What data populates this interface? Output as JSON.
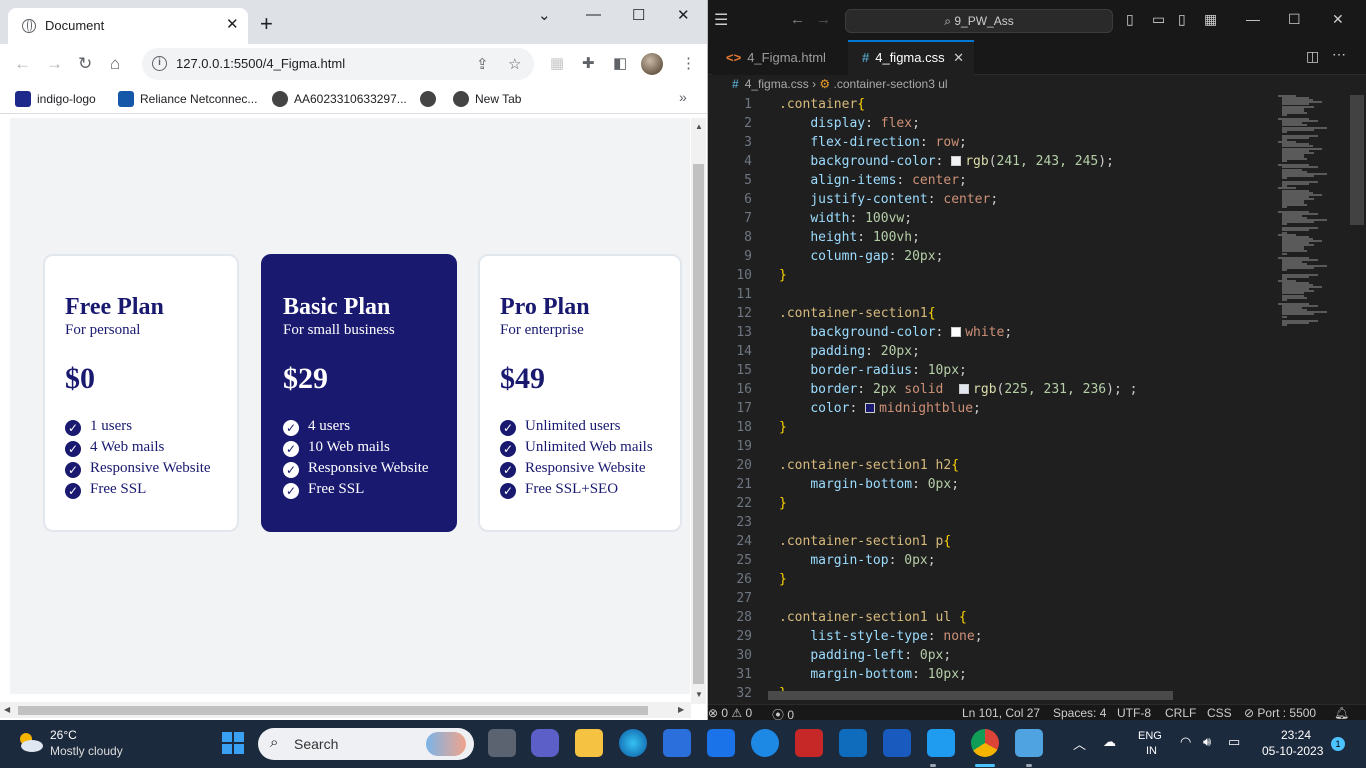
{
  "browser": {
    "tab_title": "Document",
    "url": "127.0.0.1:5500/4_Figma.html",
    "bookmarks": [
      {
        "label": "indigo-logo"
      },
      {
        "label": "Reliance Netconnec..."
      },
      {
        "label": "AA6023310633297..."
      },
      {
        "label": ""
      },
      {
        "label": "New Tab"
      }
    ]
  },
  "plans": [
    {
      "name": "Free Plan",
      "subtitle": "For personal",
      "price": "$0",
      "features": [
        "1 users",
        "4 Web mails",
        "Responsive Website",
        "Free SSL"
      ]
    },
    {
      "name": "Basic Plan",
      "subtitle": "For small business",
      "price": "$29",
      "features": [
        "4 users",
        "10 Web mails",
        "Responsive Website",
        "Free SSL"
      ]
    },
    {
      "name": "Pro Plan",
      "subtitle": "For enterprise",
      "price": "$49",
      "features": [
        "Unlimited users",
        "Unlimited Web mails",
        "Responsive Website",
        "Free SSL+SEO"
      ]
    }
  ],
  "colors": {
    "plan_accent": "#191970",
    "page_bg": "#f1f3f5"
  },
  "vscode": {
    "search": "9_PW_Ass",
    "tabs": [
      {
        "label": "4_Figma.html"
      },
      {
        "label": "4_figma.css"
      }
    ],
    "breadcrumb_file": "4_figma.css",
    "breadcrumb_symbol": ".container-section3 ul",
    "lines": [
      {
        "n": "1",
        "sel": ".container",
        "brace": "{"
      },
      {
        "n": "2",
        "prop": "display",
        "val": "flex"
      },
      {
        "n": "3",
        "prop": "flex-direction",
        "val": "row"
      },
      {
        "n": "4",
        "prop": "background-color",
        "swatch": "#f1f3f5",
        "fn": "rgb",
        "args": "241, 243, 245"
      },
      {
        "n": "5",
        "prop": "align-items",
        "val": "center"
      },
      {
        "n": "6",
        "prop": "justify-content",
        "val": "center"
      },
      {
        "n": "7",
        "prop": "width",
        "num": "100vw"
      },
      {
        "n": "8",
        "prop": "height",
        "num": "100vh"
      },
      {
        "n": "9",
        "prop": "column-gap",
        "num": "20px"
      },
      {
        "n": "10",
        "brace": "}"
      },
      {
        "n": "11"
      },
      {
        "n": "12",
        "sel": ".container-section1",
        "brace": "{"
      },
      {
        "n": "13",
        "prop": "background-color",
        "swatch": "#ffffff",
        "val": "white"
      },
      {
        "n": "14",
        "prop": "padding",
        "num": "20px"
      },
      {
        "n": "15",
        "prop": "border-radius",
        "num": "10px"
      },
      {
        "n": "16",
        "prop": "border",
        "num": "2px",
        "val": "solid",
        "swatch": "#e1e7ec",
        "fn": "rgb",
        "args": "225, 231, 236",
        "tail": " ;"
      },
      {
        "n": "17",
        "prop": "color",
        "swatch": "#191970",
        "val": "midnightblue"
      },
      {
        "n": "18",
        "brace": "}"
      },
      {
        "n": "19"
      },
      {
        "n": "20",
        "sel": ".container-section1 h2",
        "brace": "{"
      },
      {
        "n": "21",
        "prop": "margin-bottom",
        "num": "0px"
      },
      {
        "n": "22",
        "brace": "}"
      },
      {
        "n": "23"
      },
      {
        "n": "24",
        "sel": ".container-section1 p",
        "brace": "{"
      },
      {
        "n": "25",
        "prop": "margin-top",
        "num": "0px"
      },
      {
        "n": "26",
        "brace": "}"
      },
      {
        "n": "27"
      },
      {
        "n": "28",
        "sel": ".container-section1 ul ",
        "brace": "{"
      },
      {
        "n": "29",
        "prop": "list-style-type",
        "val": "none"
      },
      {
        "n": "30",
        "prop": "padding-left",
        "num": "0px"
      },
      {
        "n": "31",
        "prop": "margin-bottom",
        "num": "10px"
      },
      {
        "n": "32",
        "brace": "}"
      }
    ],
    "status": {
      "errors": "0",
      "warnings": "0",
      "ports": "0",
      "position": "Ln 101, Col 27",
      "spaces": "Spaces: 4",
      "encoding": "UTF-8",
      "eol": "CRLF",
      "language": "CSS",
      "port": "Port : 5500"
    }
  },
  "taskbar": {
    "temperature": "26°C",
    "weather": "Mostly cloudy",
    "search": "Search",
    "lang_top": "ENG",
    "lang_bottom": "IN",
    "time": "23:24",
    "date": "05-10-2023",
    "notifications": "1"
  }
}
